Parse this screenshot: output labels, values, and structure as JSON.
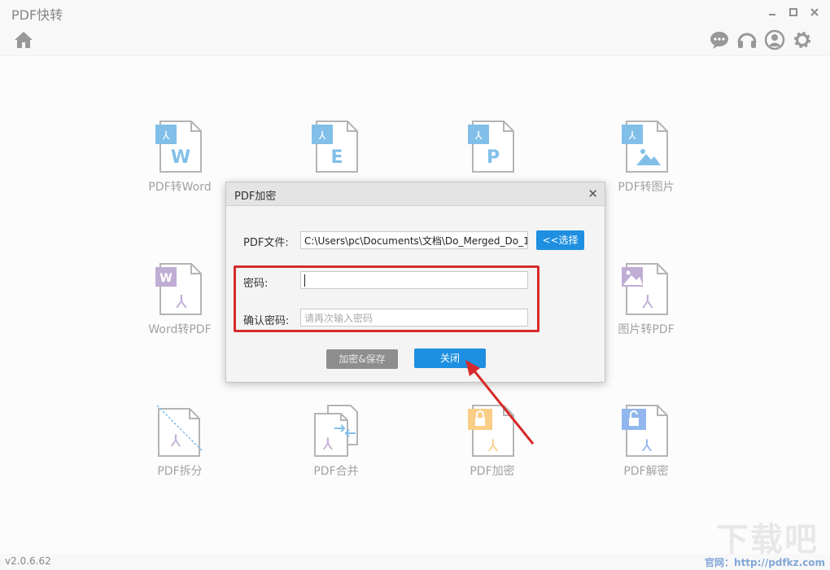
{
  "app": {
    "title": "PDF快转"
  },
  "tools": [
    {
      "label": "PDF转Word"
    },
    {
      "label": ""
    },
    {
      "label": ""
    },
    {
      "label": "PDF转图片"
    },
    {
      "label": "Word转PDF"
    },
    {
      "label": "图片转PDF"
    },
    {
      "label": "PDF拆分"
    },
    {
      "label": "PDF合并"
    },
    {
      "label": "PDF加密"
    },
    {
      "label": "PDF解密"
    }
  ],
  "dialog": {
    "title": "PDF加密",
    "file_label": "PDF文件:",
    "file_value": "C:\\Users\\pc\\Documents\\文档\\Do_Merged_Do_1",
    "choose_button": "<<选择",
    "password_label": "密码:",
    "password_value": "",
    "confirm_label": "确认密码:",
    "confirm_placeholder": "请再次输入密码",
    "encrypt_button": "加密&保存",
    "close_button": "关闭"
  },
  "status": {
    "version": "v2.0.6.62",
    "site": "官网：http://pdfkz.com"
  },
  "watermark": "下载吧",
  "colors": {
    "accent": "#1e8fe1",
    "pdf_blue": "#1a8ad8",
    "word_purple": "#8c6bb1",
    "lock_orange": "#f5a623",
    "highlight_red": "#d62b2b"
  }
}
